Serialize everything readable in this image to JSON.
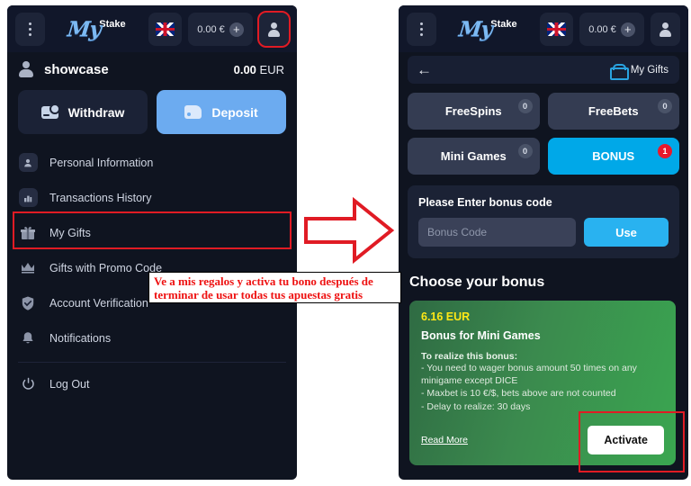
{
  "topbar": {
    "kebab_icon": "kebab-menu-icon",
    "logo_my": "My",
    "logo_stake": "Stake",
    "flag_icon": "uk-flag-icon",
    "balance": "0.00 €",
    "plus_icon": "+",
    "user_icon": "user-avatar-icon"
  },
  "left": {
    "account": {
      "name": "showcase",
      "balance_amount": "0.00",
      "balance_currency": "EUR"
    },
    "actions": {
      "withdraw": "Withdraw",
      "deposit": "Deposit"
    },
    "menu": [
      {
        "label": "Personal Information",
        "icon": "person-icon"
      },
      {
        "label": "Transactions History",
        "icon": "chart-bars-icon"
      },
      {
        "label": "My Gifts",
        "icon": "gift-box-icon"
      },
      {
        "label": "Gifts with Promo Code",
        "icon": "crown-icon"
      },
      {
        "label": "Account Verification",
        "icon": "shield-check-icon"
      },
      {
        "label": "Notifications",
        "icon": "bell-icon"
      }
    ],
    "logout": {
      "label": "Log Out",
      "icon": "power-icon"
    }
  },
  "right": {
    "gifts_bar": {
      "back_icon": "back-arrow-icon",
      "gift_icon": "gift-box-icon",
      "title": "My Gifts"
    },
    "tabs": [
      {
        "label": "FreeSpins",
        "badge": "0",
        "active": false
      },
      {
        "label": "FreeBets",
        "badge": "0",
        "active": false
      },
      {
        "label": "Mini Games",
        "badge": "0",
        "active": false
      },
      {
        "label": "BONUS",
        "badge": "1",
        "active": true
      }
    ],
    "bonus_code": {
      "title": "Please Enter bonus code",
      "input_value": "",
      "input_placeholder": "Bonus Code",
      "use_label": "Use"
    },
    "choose_title": "Choose your bonus",
    "bonus_card": {
      "amount": "6.16 EUR",
      "name": "Bonus for Mini Games",
      "conditions_head": "To realize this bonus:",
      "condition_1": "- You need to wager bonus amount 50 times on any minigame except DICE",
      "condition_2": "- Maxbet is 10 €/$, bets above are not counted",
      "condition_3": "- Delay to realize: 30 days",
      "read_more": "Read More",
      "activate": "Activate"
    }
  },
  "annotation": {
    "line1": "Ve a mis regalos y activa tu bono después de",
    "line2": "terminar de usar todas tus apuestas gratis"
  },
  "colors": {
    "panel_bg": "#0f1420",
    "accent_blue": "#29b2f0",
    "deposit_blue": "#6cabf0",
    "tab_active": "#00a8e8",
    "badge_alert": "#e8192c",
    "bonus_green": "#3aa650",
    "bonus_amount_yellow": "#ffe816",
    "highlight_red": "#e01b24",
    "annotation_red": "#ee1111"
  }
}
